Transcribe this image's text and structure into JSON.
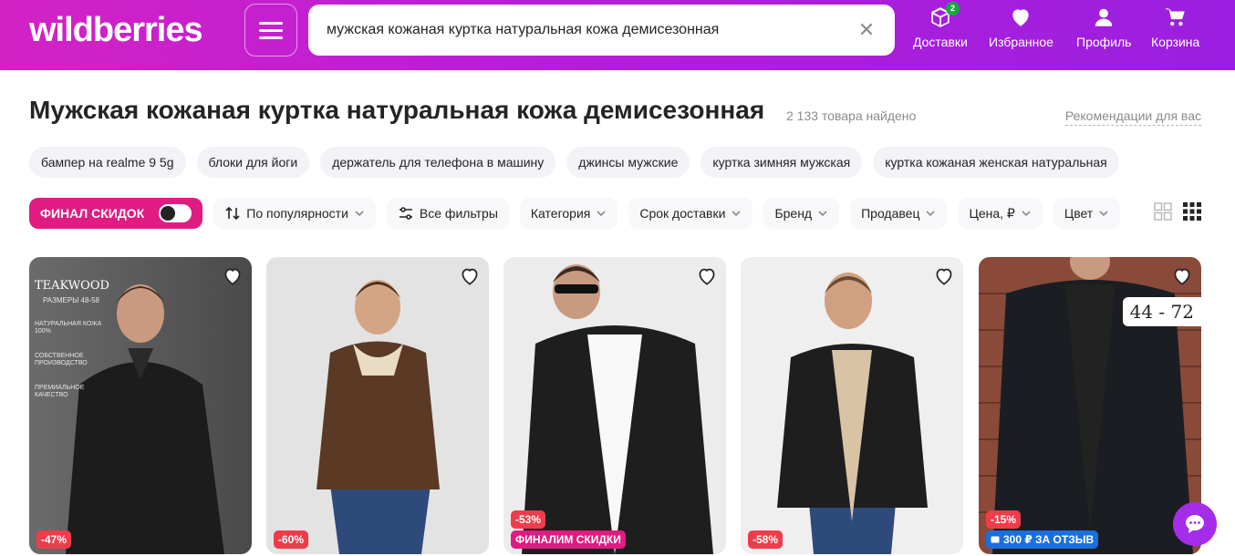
{
  "header": {
    "logo": "wildberries",
    "search_value": "мужская кожаная куртка натуральная кожа демисезонная",
    "nav": [
      {
        "label": "Доставки",
        "icon": "box-icon",
        "badge": "2"
      },
      {
        "label": "Избранное",
        "icon": "heart-icon"
      },
      {
        "label": "Профиль",
        "icon": "user-icon"
      },
      {
        "label": "Корзина",
        "icon": "cart-icon"
      }
    ]
  },
  "page": {
    "title": "Мужская кожаная куртка натуральная кожа демисезонная",
    "found": "2 133 товара найдено",
    "recommend": "Рекомендации для вас"
  },
  "chips": [
    "бампер на realme 9 5g",
    "блоки для йоги",
    "держатель для телефона в машину",
    "джинсы мужские",
    "куртка зимняя мужская",
    "куртка кожаная женская натуральная"
  ],
  "filters": {
    "final_sale": "ФИНАЛ СКИДОК",
    "sort": "По популярности",
    "all_filters": "Все фильтры",
    "category": "Категория",
    "delivery": "Срок доставки",
    "brand": "Бренд",
    "seller": "Продавец",
    "price": "Цена, ₽",
    "color": "Цвет"
  },
  "products": [
    {
      "discount": "-47%",
      "brand_name": "TEAKWOOD",
      "brand_sub": "РАЗМЕРЫ 48-58",
      "features": [
        "Натуральная кожа 100%",
        "Собственное производство",
        "Премиальное качество"
      ]
    },
    {
      "discount": "-60%"
    },
    {
      "discount": "-53%",
      "promo": "ФИНАЛИМ СКИДКИ"
    },
    {
      "discount": "-58%"
    },
    {
      "discount": "-15%",
      "promo": "300 ₽ ЗА ОТЗЫВ",
      "size_tag": "44 - 72"
    }
  ],
  "colors": {
    "brand_pink": "#d322c4",
    "brand_purple": "#9a1fe0",
    "discount_red": "#f03c4a",
    "promo_pink": "#e01b82",
    "promo_blue": "#1a6fe0"
  }
}
